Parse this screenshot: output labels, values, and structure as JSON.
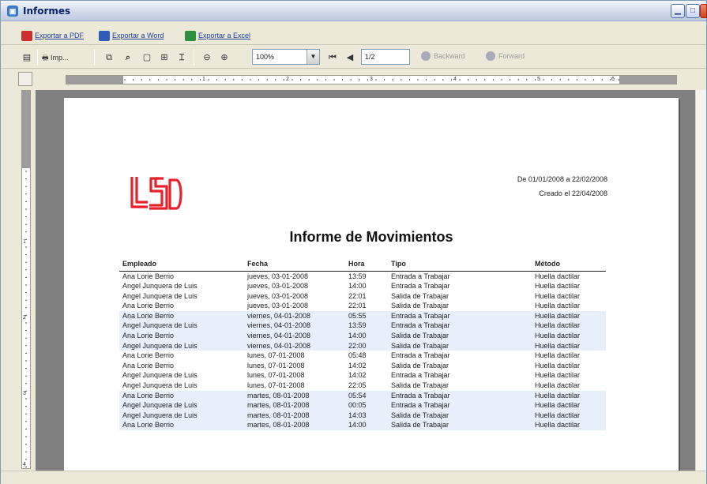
{
  "window": {
    "title": "Informes"
  },
  "export_bar": {
    "pdf_label": "Exportar a PDF",
    "word_label": "Exportar a Word",
    "excel_label": "Exportar a Excel"
  },
  "toolbar": {
    "print_label": "Imp...",
    "zoom_value": "100%",
    "page_value": "1/2",
    "back_label": "Backward",
    "forward_label": "Forward"
  },
  "ruler": {
    "numbers": [
      "1",
      "2",
      "3",
      "4",
      "5",
      "6"
    ]
  },
  "report": {
    "date_range": "De 01/01/2008 a 22/02/2008",
    "created": "Creado el 22/04/2008",
    "title": "Informe de Movimientos",
    "columns": [
      "Empleado",
      "Fecha",
      "Hora",
      "Tipo",
      "Método"
    ],
    "rows": [
      [
        "Ana Lorie Berrio",
        "jueves, 03-01-2008",
        "13:59",
        "Entrada a Trabajar",
        "Huella dactilar"
      ],
      [
        "Angel Junquera de Luis",
        "jueves, 03-01-2008",
        "14:00",
        "Entrada a Trabajar",
        "Huella dactilar"
      ],
      [
        "Angel Junquera de Luis",
        "jueves, 03-01-2008",
        "22:01",
        "Salida de Trabajar",
        "Huella dactilar"
      ],
      [
        "Ana Lorie Berrio",
        "jueves, 03-01-2008",
        "22:01",
        "Salida de Trabajar",
        "Huella dactilar"
      ],
      [
        "Ana Lorie Berrio",
        "viernes, 04-01-2008",
        "05:55",
        "Entrada a Trabajar",
        "Huella dactilar"
      ],
      [
        "Angel Junquera de Luis",
        "viernes, 04-01-2008",
        "13:59",
        "Entrada a Trabajar",
        "Huella dactilar"
      ],
      [
        "Ana Lorie Berrio",
        "viernes, 04-01-2008",
        "14:00",
        "Salida de Trabajar",
        "Huella dactilar"
      ],
      [
        "Angel Junquera de Luis",
        "viernes, 04-01-2008",
        "22:00",
        "Salida de Trabajar",
        "Huella dactilar"
      ],
      [
        "Ana Lorie Berrio",
        "lunes, 07-01-2008",
        "05:48",
        "Entrada a Trabajar",
        "Huella dactilar"
      ],
      [
        "Ana Lorie Berrio",
        "lunes, 07-01-2008",
        "14:02",
        "Salida de Trabajar",
        "Huella dactilar"
      ],
      [
        "Angel Junquera de Luis",
        "lunes, 07-01-2008",
        "14:02",
        "Entrada a Trabajar",
        "Huella dactilar"
      ],
      [
        "Angel Junquera de Luis",
        "lunes, 07-01-2008",
        "22:05",
        "Salida de Trabajar",
        "Huella dactilar"
      ],
      [
        "Ana Lorie Berrio",
        "martes, 08-01-2008",
        "05:54",
        "Entrada a Trabajar",
        "Huella dactilar"
      ],
      [
        "Angel Junquera de Luis",
        "martes, 08-01-2008",
        "00:05",
        "Entrada a Trabajar",
        "Huella dactilar"
      ],
      [
        "Angel Junquera de Luis",
        "martes, 08-01-2008",
        "14:03",
        "Salida de Trabajar",
        "Huella dactilar"
      ],
      [
        "Ana Lorie Berrio",
        "martes, 08-01-2008",
        "14:00",
        "Salida de Trabajar",
        "Huella dactilar"
      ]
    ]
  },
  "colors": {
    "logo_red": "#e8202a",
    "row_shade": "#e6effa"
  }
}
